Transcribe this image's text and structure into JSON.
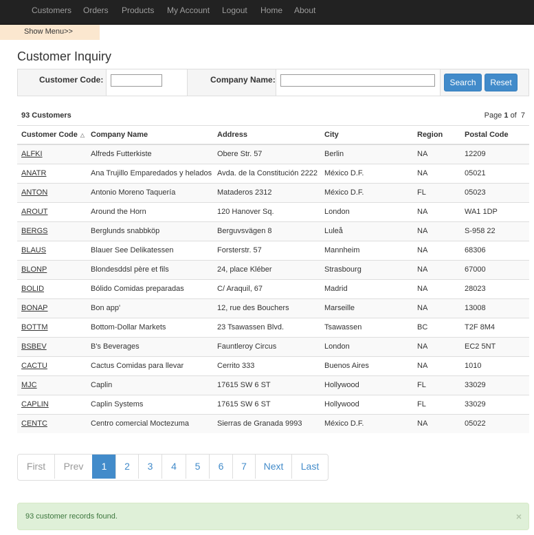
{
  "nav": {
    "items": [
      "Customers",
      "Orders",
      "Products",
      "My Account",
      "Logout",
      "Home",
      "About"
    ]
  },
  "show_menu_label": "Show Menu>>",
  "page_title": "Customer Inquiry",
  "filter": {
    "customer_code_label": "Customer Code:",
    "customer_code_value": "",
    "company_name_label": "Company Name:",
    "company_name_value": "",
    "search_label": "Search",
    "reset_label": "Reset"
  },
  "summary": {
    "count_text": "93 Customers",
    "page_prefix": "Page",
    "current_page": "1",
    "of_text": "of",
    "total_pages": "7"
  },
  "table": {
    "headers": [
      "Customer Code",
      "Company Name",
      "Address",
      "City",
      "Region",
      "Postal Code"
    ],
    "sort_icon": "sort-asc-icon",
    "rows": [
      [
        "ALFKI",
        "Alfreds Futterkiste",
        "Obere Str. 57",
        "Berlin",
        "NA",
        "12209"
      ],
      [
        "ANATR",
        "Ana Trujillo Emparedados y helados",
        "Avda. de la Constitución 2222",
        "México D.F.",
        "NA",
        "05021"
      ],
      [
        "ANTON",
        "Antonio Moreno Taquería",
        "Mataderos 2312",
        "México D.F.",
        "FL",
        "05023"
      ],
      [
        "AROUT",
        "Around the Horn",
        "120 Hanover Sq.",
        "London",
        "NA",
        "WA1 1DP"
      ],
      [
        "BERGS",
        "Berglunds snabbköp",
        "Berguvsvägen 8",
        "Luleå",
        "NA",
        "S-958 22"
      ],
      [
        "BLAUS",
        "Blauer See Delikatessen",
        "Forsterstr. 57",
        "Mannheim",
        "NA",
        "68306"
      ],
      [
        "BLONP",
        "Blondesddsl père et fils",
        "24, place Kléber",
        "Strasbourg",
        "NA",
        "67000"
      ],
      [
        "BOLID",
        "Bólido Comidas preparadas",
        "C/ Araquil, 67",
        "Madrid",
        "NA",
        "28023"
      ],
      [
        "BONAP",
        "Bon app'",
        "12, rue des Bouchers",
        "Marseille",
        "NA",
        "13008"
      ],
      [
        "BOTTM",
        "Bottom-Dollar Markets",
        "23 Tsawassen Blvd.",
        "Tsawassen",
        "BC",
        "T2F 8M4"
      ],
      [
        "BSBEV",
        "B's Beverages",
        "Fauntleroy Circus",
        "London",
        "NA",
        "EC2 5NT"
      ],
      [
        "CACTU",
        "Cactus Comidas para llevar",
        "Cerrito 333",
        "Buenos Aires",
        "NA",
        "1010"
      ],
      [
        "MJC",
        "Caplin",
        "17615 SW 6 ST",
        "Hollywood",
        "FL",
        "33029"
      ],
      [
        "CAPLIN",
        "Caplin Systems",
        "17615 SW 6 ST",
        "Hollywood",
        "FL",
        "33029"
      ],
      [
        "CENTC",
        "Centro comercial Moctezuma",
        "Sierras de Granada 9993",
        "México D.F.",
        "NA",
        "05022"
      ]
    ]
  },
  "pagination": {
    "first": "First",
    "prev": "Prev",
    "pages": [
      "1",
      "2",
      "3",
      "4",
      "5",
      "6",
      "7"
    ],
    "active_page": "1",
    "next": "Next",
    "last": "Last"
  },
  "alert": {
    "message": "93 customer records found.",
    "close_symbol": "×"
  },
  "colors": {
    "navbar_bg": "#222222",
    "primary": "#428bca",
    "show_menu_bg": "#fbe7cf",
    "alert_bg": "#dff0d8"
  }
}
